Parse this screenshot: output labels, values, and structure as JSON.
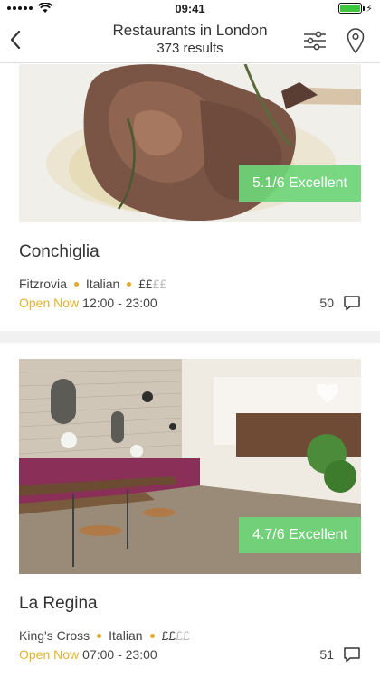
{
  "status": {
    "time": "09:41"
  },
  "nav": {
    "title": "Restaurants in London",
    "subtitle": "373 results"
  },
  "restaurants": [
    {
      "name": "Conchiglia",
      "area": "Fitzrovia",
      "cuisine": "Italian",
      "price_on": "££",
      "price_off": "££",
      "open_label": "Open Now",
      "hours": "12:00 - 23:00",
      "reviews": "50",
      "rating": "5.1/6 Excellent"
    },
    {
      "name": "La Regina",
      "area": "King's Cross",
      "cuisine": "Italian",
      "price_on": "££",
      "price_off": "££",
      "open_label": "Open Now",
      "hours": "07:00 - 23:00",
      "reviews": "51",
      "rating": "4.7/6 Excellent"
    }
  ],
  "icons": [
    "back-chevron-icon",
    "filter-sliders-icon",
    "map-pin-icon",
    "comment-icon",
    "heart-icon"
  ],
  "colors": {
    "accent_green": "#6ed678",
    "open_yellow": "#e3b230",
    "dot_orange": "#e3a92b"
  }
}
